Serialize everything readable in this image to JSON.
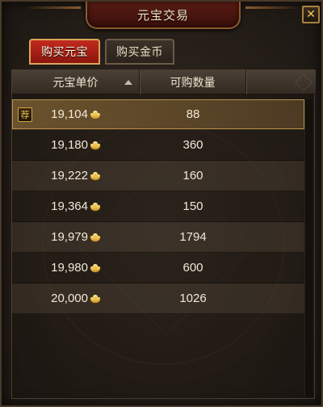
{
  "window": {
    "title": "元宝交易",
    "close_label": "✕"
  },
  "tabs": [
    {
      "label": "购买元宝",
      "active": true
    },
    {
      "label": "购买金币",
      "active": false
    }
  ],
  "table": {
    "headers": {
      "price": "元宝单价",
      "quantity": "可购数量"
    },
    "sort": "ascending",
    "currency_icon": "gold-ingot-icon",
    "recommended_badge": "荐",
    "rows": [
      {
        "price": "19,104",
        "quantity": "88",
        "recommended": true
      },
      {
        "price": "19,180",
        "quantity": "360"
      },
      {
        "price": "19,222",
        "quantity": "160"
      },
      {
        "price": "19,364",
        "quantity": "150"
      },
      {
        "price": "19,979",
        "quantity": "1794"
      },
      {
        "price": "19,980",
        "quantity": "600"
      },
      {
        "price": "20,000",
        "quantity": "1026"
      }
    ]
  },
  "colors": {
    "accent_red": "#c22a1e",
    "gold": "#d4a53c"
  }
}
